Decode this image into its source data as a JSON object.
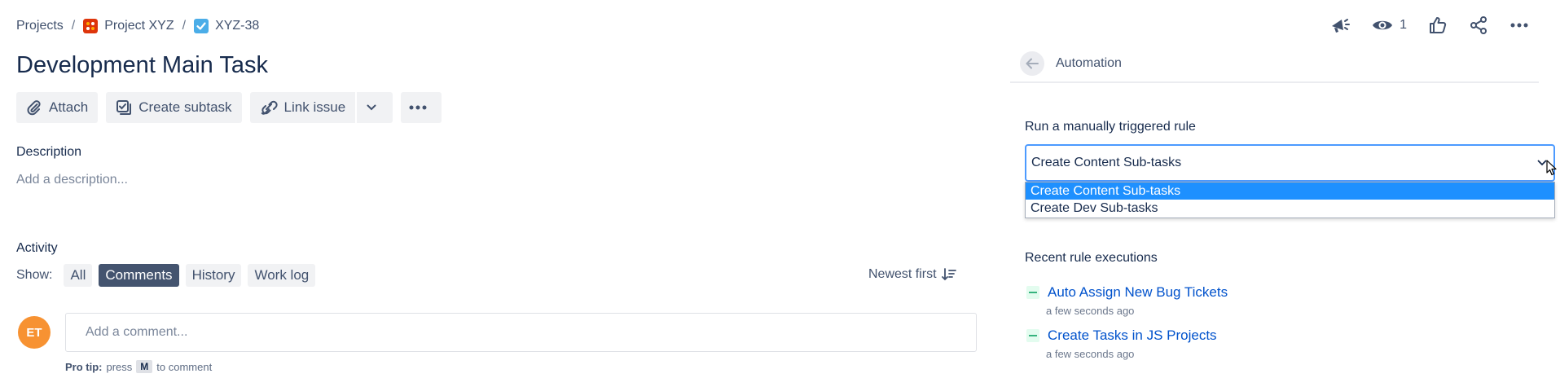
{
  "breadcrumb": {
    "projects": "Projects",
    "project": "Project XYZ",
    "issue_key": "XYZ-38",
    "separator": "/"
  },
  "header": {
    "watch_count": "1"
  },
  "issue": {
    "title": "Development Main Task"
  },
  "toolbar": {
    "attach": "Attach",
    "create_subtask": "Create subtask",
    "link_issue": "Link issue"
  },
  "description": {
    "label": "Description",
    "placeholder": "Add a description..."
  },
  "activity": {
    "label": "Activity",
    "show_label": "Show:",
    "filters": [
      "All",
      "Comments",
      "History",
      "Work log"
    ],
    "active_filter": "Comments",
    "sort_label": "Newest first"
  },
  "comment": {
    "avatar_initials": "ET",
    "placeholder": "Add a comment...",
    "protip_prefix": "Pro tip:",
    "protip_press": "press",
    "protip_key": "M",
    "protip_suffix": "to comment"
  },
  "automation": {
    "title": "Automation",
    "run_label": "Run a manually triggered rule",
    "selected_rule": "Create Content Sub-tasks",
    "rule_options": [
      "Create Content Sub-tasks",
      "Create Dev Sub-tasks"
    ],
    "recent_label": "Recent rule executions",
    "executions": [
      {
        "name": "Auto Assign New Bug Tickets",
        "time": "a few seconds ago"
      },
      {
        "name": "Create Tasks in JS Projects",
        "time": "a few seconds ago"
      }
    ]
  },
  "colors": {
    "accent": "#0052cc",
    "active_chip": "#44546f",
    "avatar": "#f79232",
    "success": "#36b37e",
    "select_focus": "#4c9aff",
    "option_selected": "#1e90ff"
  },
  "icons": {
    "project": "project-grid-icon",
    "issue_type": "task-checkbox-icon",
    "announce": "megaphone-icon",
    "watch": "eye-icon",
    "vote": "thumbs-up-icon",
    "share": "share-icon",
    "more": "more-icon"
  }
}
